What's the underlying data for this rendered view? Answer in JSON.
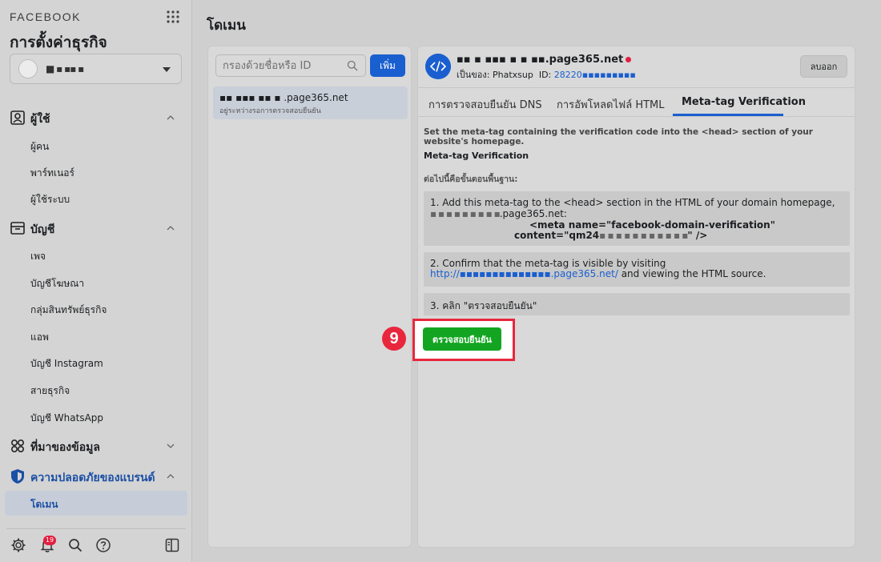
{
  "sidebar": {
    "brand": "FACEBOOK",
    "title": "การตั้งค่าธุรกิจ",
    "account_name": "■ ▪ ▪▪ ▪",
    "sections": {
      "users": {
        "label": "ผู้ใช้",
        "items": [
          "ผู้คน",
          "พาร์ทเนอร์",
          "ผู้ใช้ระบบ"
        ]
      },
      "accounts": {
        "label": "บัญชี",
        "items": [
          "เพจ",
          "บัญชีโฆษณา",
          "กลุ่มสินทรัพย์ธุรกิจ",
          "แอพ",
          "บัญชี Instagram",
          "สายธุรกิจ",
          "บัญชี WhatsApp"
        ]
      },
      "data_sources": {
        "label": "ที่มาของข้อมูล"
      },
      "brand_safety": {
        "label": "ความปลอดภัยของแบรนด์",
        "items": [
          "โดเมน"
        ]
      }
    },
    "notification_count": "19"
  },
  "main": {
    "title": "โดเมน",
    "search": {
      "placeholder": "กรองด้วยชื่อหรือ ID",
      "value": ""
    },
    "add_label": "เพิ่ม",
    "domains": [
      {
        "name": "▪▪ ▪▪▪ ▪▪ ▪ .page365.net",
        "status": "อยู่ระหว่างรอการตรวจสอบยืนยัน"
      }
    ]
  },
  "detail": {
    "domain": "▪▪ ▪ ▪▪▪ ▪ ▪ ▪▪.page365.net",
    "owner_label": "เป็นของ:",
    "owner_name": "Phatxsup",
    "id_label": "ID:",
    "id_value": "28220▪▪▪▪▪▪▪▪▪",
    "remove_label": "ลบออก",
    "tabs": [
      "การตรวจสอบยืนยัน DNS",
      "การอัพโหลดไฟล์ HTML",
      "Meta-tag Verification"
    ],
    "intro": "Set the meta-tag containing the verification code into the <head> section of your website's homepage.",
    "section_title": "Meta-tag Verification",
    "steps_label": "ต่อไปนี้คือขั้นตอนพื้นฐาน:",
    "step1_line1": "1. Add this meta-tag to the <head> section in the HTML of your domain homepage,",
    "step1_domain_blur": "▪ ▪ ▪ ▪ ▪ ▪ ▪ ▪ ▪",
    "step1_domain_suffix": ".page365.net:",
    "step1_meta_line1": "<meta name=\"facebook-domain-verification\"",
    "step1_meta_prefix": "content=\"qm24",
    "step1_meta_blur": "▪ ▪ ▪ ▪ ▪ ▪ ▪ ▪ ▪ ▪ ▪",
    "step1_meta_suffix": "\" />",
    "step2_line1": "2. Confirm that the meta-tag is visible by visiting",
    "step2_link": "http://▪▪▪▪▪▪▪▪▪▪▪▪▪▪.page365.net/",
    "step2_suffix": " and viewing the HTML source.",
    "step3": "3. คลิก \"ตรวจสอบยืนยัน\"",
    "verify_label": "ตรวจสอบยืนยัน",
    "step_badge": "9"
  },
  "colors": {
    "accent": "#1a5fcf",
    "verify_green": "#13a521",
    "highlight_red": "#e8273d"
  }
}
